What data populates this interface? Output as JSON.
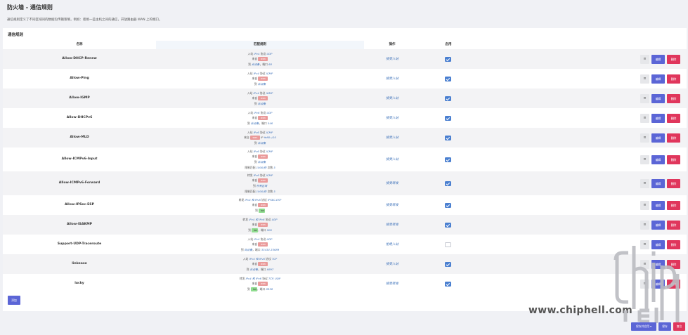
{
  "page": {
    "title": "防火墙 - 通信规则",
    "description": "通信规则定义了不同区域间的数据包传输策略，例如：拒绝一些主机之间的通信，开放路由器 WAN 上的端口。",
    "section_title": "通信规则"
  },
  "table": {
    "headers": {
      "name": "名称",
      "match": "匹配规则",
      "action": "操作",
      "enable": "启用"
    },
    "rows": [
      {
        "name": "Allow-DHCP-Renew",
        "action": "接受入站",
        "enabled": true,
        "match": {
          "l1": [
            "入站 ",
            "IPv4",
            " 协议 ",
            "UDP"
          ],
          "l2": [
            "来自 ",
            "wan"
          ],
          "l3": [
            "到 ",
            "此设备",
            "，端口 ",
            "68"
          ]
        }
      },
      {
        "name": "Allow-Ping",
        "action": "接受入站",
        "enabled": true,
        "match": {
          "l1": [
            "入站 ",
            "IPv4",
            " 协议 ",
            "ICMP"
          ],
          "l2": [
            "来自 ",
            "wan"
          ],
          "l3": [
            "到 ",
            "此设备"
          ]
        }
      },
      {
        "name": "Allow-IGMP",
        "action": "接受入站",
        "enabled": true,
        "match": {
          "l1": [
            "入站 ",
            "IPv4",
            " 协议 ",
            "IGMP"
          ],
          "l2": [
            "来自 ",
            "wan"
          ],
          "l3": [
            "到 ",
            "此设备"
          ]
        }
      },
      {
        "name": "Allow-DHCPv6",
        "action": "接受入站",
        "enabled": true,
        "match": {
          "l1": [
            "入站 ",
            "IPv6",
            " 协议 ",
            "UDP"
          ],
          "l2": [
            "来自 ",
            "wan"
          ],
          "l3": [
            "到 ",
            "此设备",
            "，端口 ",
            "546"
          ]
        }
      },
      {
        "name": "Allow-MLD",
        "action": "接受入站",
        "enabled": true,
        "match": {
          "l1": [
            "入站 ",
            "IPv6",
            " 协议 ",
            "ICMP"
          ],
          "l2": [
            "来自 ",
            "wan",
            " IP ",
            "fe80::/10"
          ],
          "l3": [
            "到 ",
            "此设备"
          ]
        }
      },
      {
        "name": "Allow-ICMPv6-Input",
        "action": "接受入站",
        "enabled": true,
        "match": {
          "l1": [
            "入站 ",
            "IPv6",
            " 协议 ",
            "ICMP"
          ],
          "l2": [
            "来自 ",
            "wan"
          ],
          "l3": [
            "到 ",
            "此设备"
          ],
          "l4": [
            "限制匹配 ",
            "1000/秒",
            " 次数 ",
            "5"
          ]
        }
      },
      {
        "name": "Allow-ICMPv6-Forward",
        "action": "接受转发",
        "enabled": true,
        "match": {
          "l1": [
            "转发 ",
            "IPv6",
            " 协议 ",
            "ICMP"
          ],
          "l2": [
            "来自 ",
            "wan"
          ],
          "l3": [
            "到 ",
            "所有区域"
          ],
          "l4": [
            "限制匹配 ",
            "1000/秒",
            " 次数 ",
            "5"
          ]
        }
      },
      {
        "name": "Allow-IPSec-ESP",
        "action": "接受转发",
        "enabled": true,
        "match": {
          "l1": [
            "转发 ",
            "IPv4 和 IPv6",
            " 协议 ",
            "IPSEC-ESP"
          ],
          "l2": [
            "来自 ",
            "wan"
          ],
          "l3": [
            "到 ",
            "lan"
          ]
        }
      },
      {
        "name": "Allow-ISAKMP",
        "action": "接受转发",
        "enabled": true,
        "match": {
          "l1": [
            "转发 ",
            "IPv4 和 IPv6",
            " 协议 ",
            "UDP"
          ],
          "l2": [
            "来自 ",
            "wan"
          ],
          "l3": [
            "到 ",
            "lan",
            "，端口 ",
            "500"
          ]
        }
      },
      {
        "name": "Support-UDP-Traceroute",
        "action": "拒绝入站",
        "enabled": false,
        "match": {
          "l1": [
            "入站 ",
            "IPv4",
            " 协议 ",
            "UDP"
          ],
          "l2": [
            "来自 ",
            "wan"
          ],
          "l3": [
            "到 ",
            "此设备",
            "，端口 ",
            "33434-33689"
          ]
        }
      },
      {
        "name": "linkease",
        "action": "接受入站",
        "enabled": true,
        "match": {
          "l1": [
            "入站 ",
            "IPv4 和 IPv6",
            " 协议 ",
            "TCP"
          ],
          "l2": [
            "来自 ",
            "wan"
          ],
          "l3": [
            "到 ",
            "此设备",
            "，端口 ",
            "8897"
          ]
        }
      },
      {
        "name": "lucky",
        "action": "接受转发",
        "enabled": true,
        "match": {
          "l1": [
            "转发 ",
            "IPv4 和 IPv6",
            " 协议 ",
            "TCP, UDP"
          ],
          "l2": [
            "来自 ",
            "wan"
          ],
          "l3": [
            "到 ",
            "lan",
            "，端口 ",
            "8938"
          ]
        }
      }
    ],
    "row_buttons": {
      "drag": "≡",
      "edit": "编辑",
      "delete": "删除"
    }
  },
  "buttons": {
    "add": "添加",
    "save_apply": "保存并应用",
    "save": "保存",
    "reset": "复位"
  },
  "watermark": {
    "url": "www.chiphell.com",
    "logo_text": "chiphell"
  },
  "colors": {
    "primary": "#5b65d6",
    "danger": "#e0365c",
    "tag_wan": "#ea9a9a",
    "tag_lan": "#8fdc8f",
    "checkbox": "#4a7fd0"
  }
}
